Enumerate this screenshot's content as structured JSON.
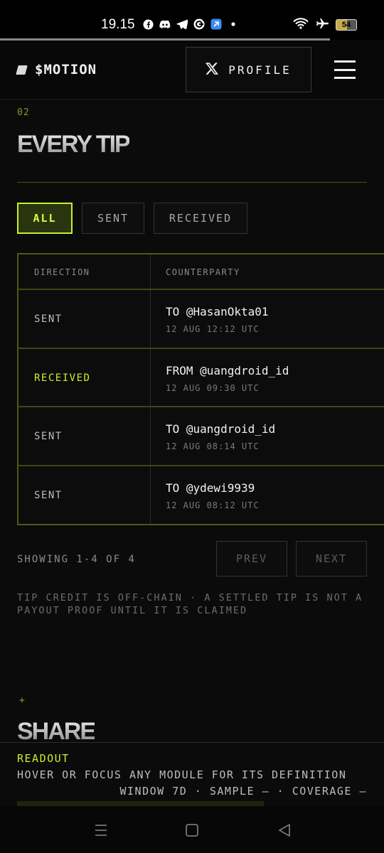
{
  "status_bar": {
    "time": "19.15",
    "battery": "54",
    "icons": [
      "facebook-icon",
      "discord-icon",
      "telegram-icon",
      "browser-icon",
      "app-icon",
      "dot-icon",
      "wifi-icon",
      "airplane-icon",
      "battery-icon"
    ]
  },
  "header": {
    "brand": "$MOTION",
    "profile_label": "PROFILE",
    "profile_icon": "x-logo-icon",
    "menu_icon": "hamburger-menu-icon"
  },
  "section": {
    "number": "02",
    "title": "EVERY TIP"
  },
  "filters": [
    {
      "label": "ALL",
      "active": true
    },
    {
      "label": "SENT",
      "active": false
    },
    {
      "label": "RECEIVED",
      "active": false
    }
  ],
  "table": {
    "headers": [
      "DIRECTION",
      "COUNTERPARTY"
    ],
    "rows": [
      {
        "direction": "SENT",
        "counterparty": "TO @HasanOkta01",
        "timestamp": "12 AUG 12:12 UTC"
      },
      {
        "direction": "RECEIVED",
        "counterparty": "FROM @uangdroid_id",
        "timestamp": "12 AUG 09:30 UTC"
      },
      {
        "direction": "SENT",
        "counterparty": "TO @uangdroid_id",
        "timestamp": "12 AUG 08:14 UTC"
      },
      {
        "direction": "SENT",
        "counterparty": "TO @ydewi9939",
        "timestamp": "12 AUG 08:12 UTC"
      }
    ]
  },
  "pagination": {
    "showing": "SHOWING 1-4 OF 4",
    "prev": "PREV",
    "next": "NEXT"
  },
  "note": "TIP CREDIT IS OFF-CHAIN · A SETTLED TIP IS NOT A PAYOUT PROOF UNTIL IT IS CLAIMED",
  "share_section": {
    "marker": "+",
    "title": "SHARE"
  },
  "readout": {
    "label": "READOUT",
    "text": "HOVER OR FOCUS ANY MODULE FOR ITS DEFINITION",
    "meta": "WINDOW 7D · SAMPLE — · COVERAGE —"
  },
  "colors": {
    "accent": "#c8ef2d",
    "background": "#0b0b0b",
    "border_accent": "#4d5a14"
  }
}
